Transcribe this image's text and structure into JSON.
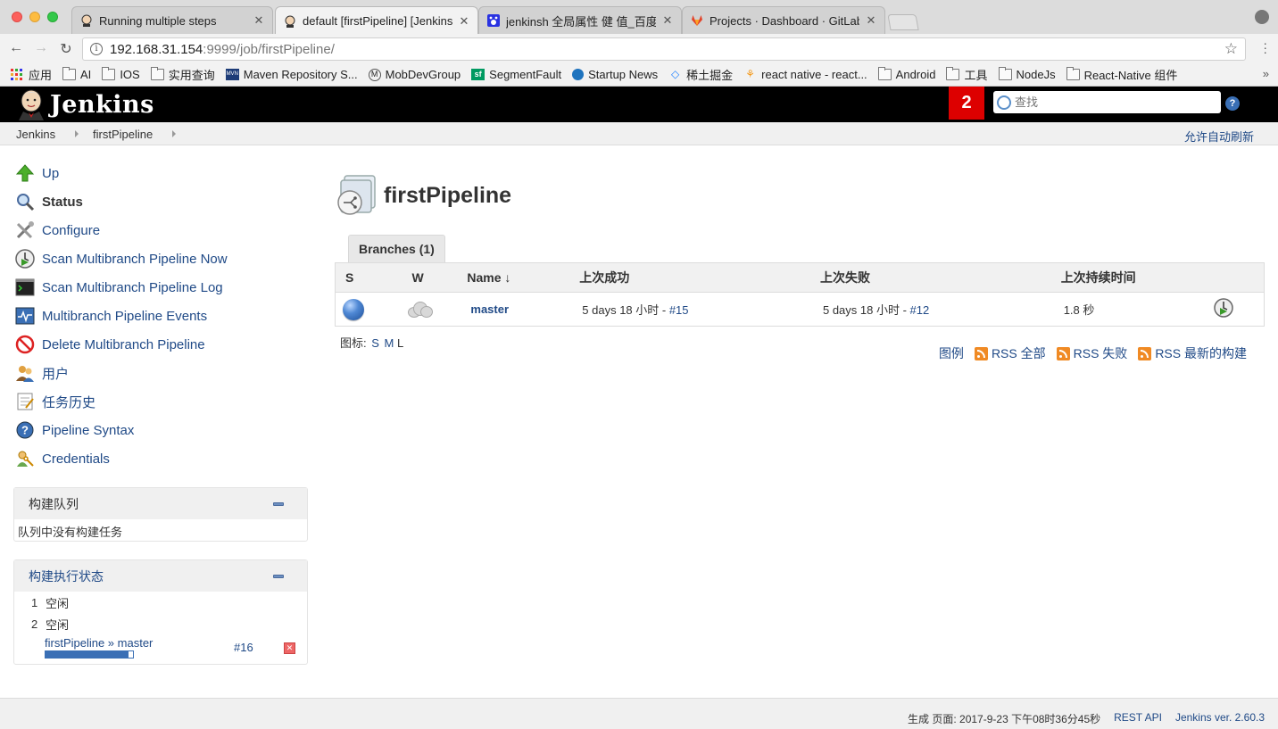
{
  "browser": {
    "tabs": [
      {
        "title": "Running multiple steps",
        "favicon": "jenkins-butler-icon"
      },
      {
        "title": "default [firstPipeline] [Jenkins]",
        "favicon": "jenkins-butler-icon"
      },
      {
        "title": "jenkinsh 全局属性 健 值_百度搜",
        "favicon": "baidu-paw-icon"
      },
      {
        "title": "Projects · Dashboard · GitLab",
        "favicon": "gitlab-fox-icon"
      }
    ],
    "url_host": "192.168.31.154",
    "url_rest": ":9999/job/firstPipeline/",
    "bookmarks": [
      {
        "label": "应用",
        "icon": "apps-grid-icon"
      },
      {
        "label": "AI",
        "icon": "folder-icon"
      },
      {
        "label": "IOS",
        "icon": "folder-icon"
      },
      {
        "label": "实用查询",
        "icon": "folder-icon"
      },
      {
        "label": "Maven Repository S...",
        "icon": "maven-icon"
      },
      {
        "label": "MobDevGroup",
        "icon": "mobdev-icon"
      },
      {
        "label": "SegmentFault",
        "icon": "segmentfault-icon"
      },
      {
        "label": "Startup News",
        "icon": "startup-news-icon"
      },
      {
        "label": "稀土掘金",
        "icon": "juejin-icon"
      },
      {
        "label": "react native - react...",
        "icon": "react-icon"
      },
      {
        "label": "Android",
        "icon": "folder-icon"
      },
      {
        "label": "工具",
        "icon": "folder-icon"
      },
      {
        "label": "NodeJs",
        "icon": "folder-icon"
      },
      {
        "label": "React-Native 组件",
        "icon": "folder-icon"
      }
    ],
    "bookmarks_more": "»"
  },
  "header": {
    "title": "Jenkins",
    "notification_count": "2",
    "search_placeholder": "查找",
    "help": "?"
  },
  "breadcrumbs": {
    "items": [
      "Jenkins",
      "firstPipeline"
    ],
    "auto_refresh": "允许自动刷新"
  },
  "sidebar": {
    "tasks": [
      {
        "label": "Up",
        "icon": "up-arrow-icon"
      },
      {
        "label": "Status",
        "icon": "search-icon"
      },
      {
        "label": "Configure",
        "icon": "configure-tools-icon"
      },
      {
        "label": "Scan Multibranch Pipeline Now",
        "icon": "scan-clock-icon"
      },
      {
        "label": "Scan Multibranch Pipeline Log",
        "icon": "terminal-icon"
      },
      {
        "label": "Multibranch Pipeline Events",
        "icon": "events-monitor-icon"
      },
      {
        "label": "Delete Multibranch Pipeline",
        "icon": "no-entry-icon"
      },
      {
        "label": "用户",
        "icon": "users-icon"
      },
      {
        "label": "任务历史",
        "icon": "notepad-icon"
      },
      {
        "label": "Pipeline Syntax",
        "icon": "help-icon"
      },
      {
        "label": "Credentials",
        "icon": "credentials-icon"
      }
    ]
  },
  "build_queue": {
    "title": "构建队列",
    "empty_text": "队列中没有构建任务"
  },
  "executors": {
    "title": "构建执行状态",
    "rows": [
      {
        "num": "1",
        "status": "空闲"
      },
      {
        "num": "2",
        "status": "空闲"
      }
    ],
    "running": {
      "job": "firstPipeline » master",
      "build": "#16",
      "progress": 0.95
    }
  },
  "main": {
    "title": "firstPipeline",
    "tab": "Branches (1)",
    "columns": [
      "S",
      "W",
      "Name ↓",
      "上次成功",
      "上次失败",
      "上次持续时间"
    ],
    "rows": [
      {
        "status_color": "#4f88d4",
        "weather": "cloudy-icon",
        "name": "master",
        "last_success_text": "5 days 18 小时 - ",
        "last_success_build": "#15",
        "last_failure_text": "5 days 18 小时 - ",
        "last_failure_build": "#12",
        "duration": "1.8 秒"
      }
    ],
    "icon_size_label": "图标: ",
    "icon_sizes": [
      "S",
      "M",
      "L"
    ],
    "legend": "图例",
    "rss_all": "RSS 全部",
    "rss_failed": "RSS 失败",
    "rss_latest": "RSS 最新的构建"
  },
  "footer": {
    "generated": "生成 页面: 2017-9-23 下午08时36分45秒",
    "rest_api": "REST API",
    "version": "Jenkins ver. 2.60.3"
  }
}
